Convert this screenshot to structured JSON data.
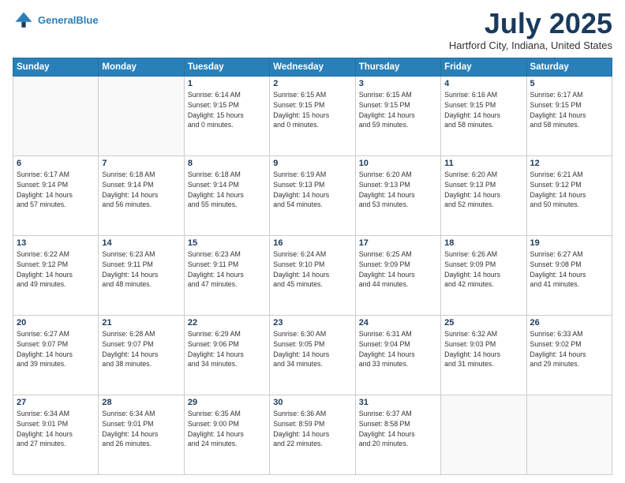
{
  "header": {
    "logo_line1": "General",
    "logo_line2": "Blue",
    "month": "July 2025",
    "location": "Hartford City, Indiana, United States"
  },
  "days_of_week": [
    "Sunday",
    "Monday",
    "Tuesday",
    "Wednesday",
    "Thursday",
    "Friday",
    "Saturday"
  ],
  "weeks": [
    [
      {
        "day": "",
        "info": ""
      },
      {
        "day": "",
        "info": ""
      },
      {
        "day": "1",
        "info": "Sunrise: 6:14 AM\nSunset: 9:15 PM\nDaylight: 15 hours\nand 0 minutes."
      },
      {
        "day": "2",
        "info": "Sunrise: 6:15 AM\nSunset: 9:15 PM\nDaylight: 15 hours\nand 0 minutes."
      },
      {
        "day": "3",
        "info": "Sunrise: 6:15 AM\nSunset: 9:15 PM\nDaylight: 14 hours\nand 59 minutes."
      },
      {
        "day": "4",
        "info": "Sunrise: 6:16 AM\nSunset: 9:15 PM\nDaylight: 14 hours\nand 58 minutes."
      },
      {
        "day": "5",
        "info": "Sunrise: 6:17 AM\nSunset: 9:15 PM\nDaylight: 14 hours\nand 58 minutes."
      }
    ],
    [
      {
        "day": "6",
        "info": "Sunrise: 6:17 AM\nSunset: 9:14 PM\nDaylight: 14 hours\nand 57 minutes."
      },
      {
        "day": "7",
        "info": "Sunrise: 6:18 AM\nSunset: 9:14 PM\nDaylight: 14 hours\nand 56 minutes."
      },
      {
        "day": "8",
        "info": "Sunrise: 6:18 AM\nSunset: 9:14 PM\nDaylight: 14 hours\nand 55 minutes."
      },
      {
        "day": "9",
        "info": "Sunrise: 6:19 AM\nSunset: 9:13 PM\nDaylight: 14 hours\nand 54 minutes."
      },
      {
        "day": "10",
        "info": "Sunrise: 6:20 AM\nSunset: 9:13 PM\nDaylight: 14 hours\nand 53 minutes."
      },
      {
        "day": "11",
        "info": "Sunrise: 6:20 AM\nSunset: 9:13 PM\nDaylight: 14 hours\nand 52 minutes."
      },
      {
        "day": "12",
        "info": "Sunrise: 6:21 AM\nSunset: 9:12 PM\nDaylight: 14 hours\nand 50 minutes."
      }
    ],
    [
      {
        "day": "13",
        "info": "Sunrise: 6:22 AM\nSunset: 9:12 PM\nDaylight: 14 hours\nand 49 minutes."
      },
      {
        "day": "14",
        "info": "Sunrise: 6:23 AM\nSunset: 9:11 PM\nDaylight: 14 hours\nand 48 minutes."
      },
      {
        "day": "15",
        "info": "Sunrise: 6:23 AM\nSunset: 9:11 PM\nDaylight: 14 hours\nand 47 minutes."
      },
      {
        "day": "16",
        "info": "Sunrise: 6:24 AM\nSunset: 9:10 PM\nDaylight: 14 hours\nand 45 minutes."
      },
      {
        "day": "17",
        "info": "Sunrise: 6:25 AM\nSunset: 9:09 PM\nDaylight: 14 hours\nand 44 minutes."
      },
      {
        "day": "18",
        "info": "Sunrise: 6:26 AM\nSunset: 9:09 PM\nDaylight: 14 hours\nand 42 minutes."
      },
      {
        "day": "19",
        "info": "Sunrise: 6:27 AM\nSunset: 9:08 PM\nDaylight: 14 hours\nand 41 minutes."
      }
    ],
    [
      {
        "day": "20",
        "info": "Sunrise: 6:27 AM\nSunset: 9:07 PM\nDaylight: 14 hours\nand 39 minutes."
      },
      {
        "day": "21",
        "info": "Sunrise: 6:28 AM\nSunset: 9:07 PM\nDaylight: 14 hours\nand 38 minutes."
      },
      {
        "day": "22",
        "info": "Sunrise: 6:29 AM\nSunset: 9:06 PM\nDaylight: 14 hours\nand 34 minutes."
      },
      {
        "day": "23",
        "info": "Sunrise: 6:30 AM\nSunset: 9:05 PM\nDaylight: 14 hours\nand 34 minutes."
      },
      {
        "day": "24",
        "info": "Sunrise: 6:31 AM\nSunset: 9:04 PM\nDaylight: 14 hours\nand 33 minutes."
      },
      {
        "day": "25",
        "info": "Sunrise: 6:32 AM\nSunset: 9:03 PM\nDaylight: 14 hours\nand 31 minutes."
      },
      {
        "day": "26",
        "info": "Sunrise: 6:33 AM\nSunset: 9:02 PM\nDaylight: 14 hours\nand 29 minutes."
      }
    ],
    [
      {
        "day": "27",
        "info": "Sunrise: 6:34 AM\nSunset: 9:01 PM\nDaylight: 14 hours\nand 27 minutes."
      },
      {
        "day": "28",
        "info": "Sunrise: 6:34 AM\nSunset: 9:01 PM\nDaylight: 14 hours\nand 26 minutes."
      },
      {
        "day": "29",
        "info": "Sunrise: 6:35 AM\nSunset: 9:00 PM\nDaylight: 14 hours\nand 24 minutes."
      },
      {
        "day": "30",
        "info": "Sunrise: 6:36 AM\nSunset: 8:59 PM\nDaylight: 14 hours\nand 22 minutes."
      },
      {
        "day": "31",
        "info": "Sunrise: 6:37 AM\nSunset: 8:58 PM\nDaylight: 14 hours\nand 20 minutes."
      },
      {
        "day": "",
        "info": ""
      },
      {
        "day": "",
        "info": ""
      }
    ]
  ]
}
